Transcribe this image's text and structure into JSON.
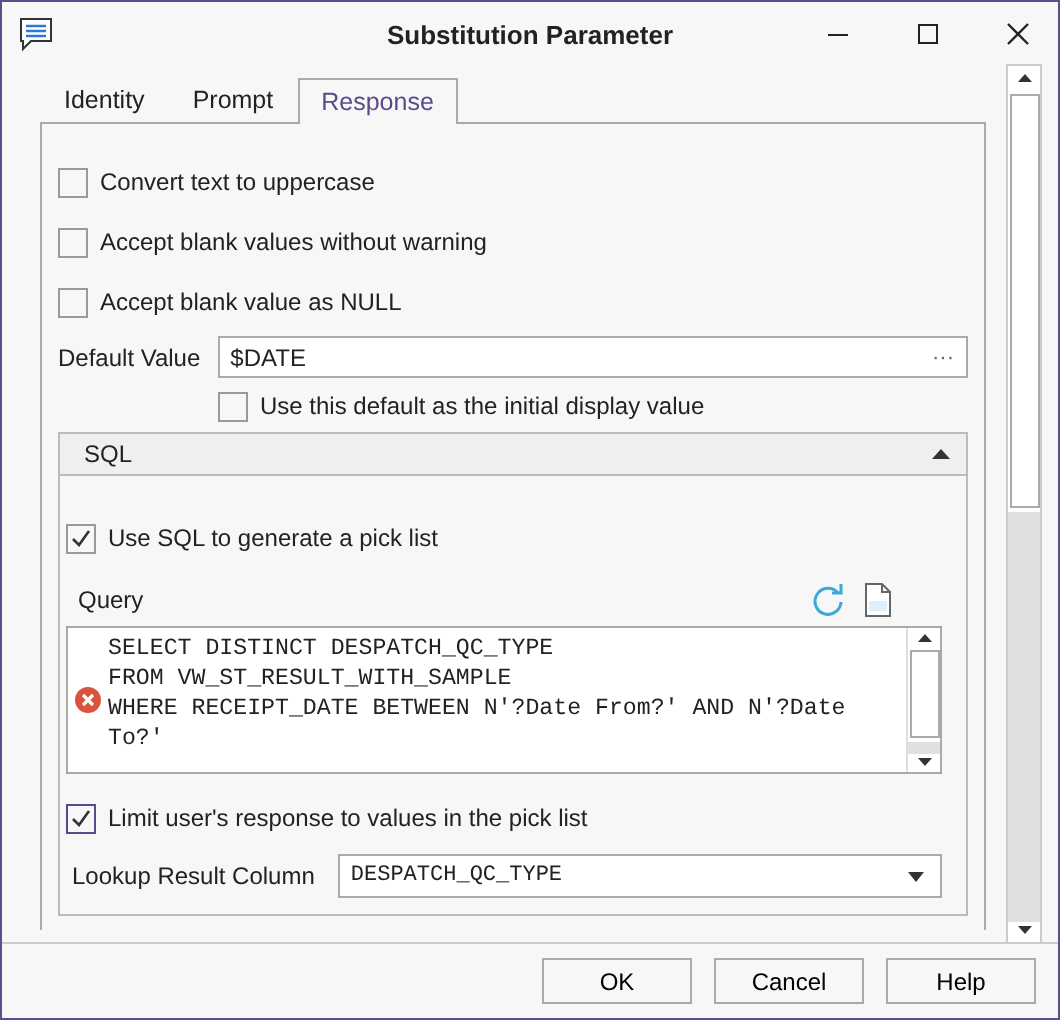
{
  "window": {
    "title": "Substitution Parameter"
  },
  "tabs": [
    {
      "label": "Identity",
      "selected": false
    },
    {
      "label": "Prompt",
      "selected": false
    },
    {
      "label": "Response",
      "selected": true
    }
  ],
  "options": [
    {
      "label": "Convert text to uppercase",
      "checked": false
    },
    {
      "label": "Accept blank values without warning",
      "checked": false
    },
    {
      "label": "Accept blank value as NULL",
      "checked": false
    }
  ],
  "default_value": {
    "label": "Default Value",
    "value": "$DATE",
    "button": "···"
  },
  "initial_display": {
    "label": "Use this default as the initial display value",
    "checked": false
  },
  "sql_section": {
    "title": "SQL",
    "expanded": true,
    "use_sql": {
      "label": "Use SQL to generate a pick list",
      "checked": true
    },
    "query": {
      "label": "Query",
      "has_error": true,
      "text": "SELECT DISTINCT DESPATCH_QC_TYPE\nFROM VW_ST_RESULT_WITH_SAMPLE\nWHERE RECEIPT_DATE BETWEEN N'?Date From?' AND N'?Date To?'"
    },
    "limit": {
      "label": "Limit user's response to values in the pick list",
      "checked": true
    },
    "lookup": {
      "label": "Lookup Result Column",
      "value": "DESPATCH_QC_TYPE"
    }
  },
  "buttons": [
    {
      "label": "OK"
    },
    {
      "label": "Cancel"
    },
    {
      "label": "Help"
    }
  ]
}
